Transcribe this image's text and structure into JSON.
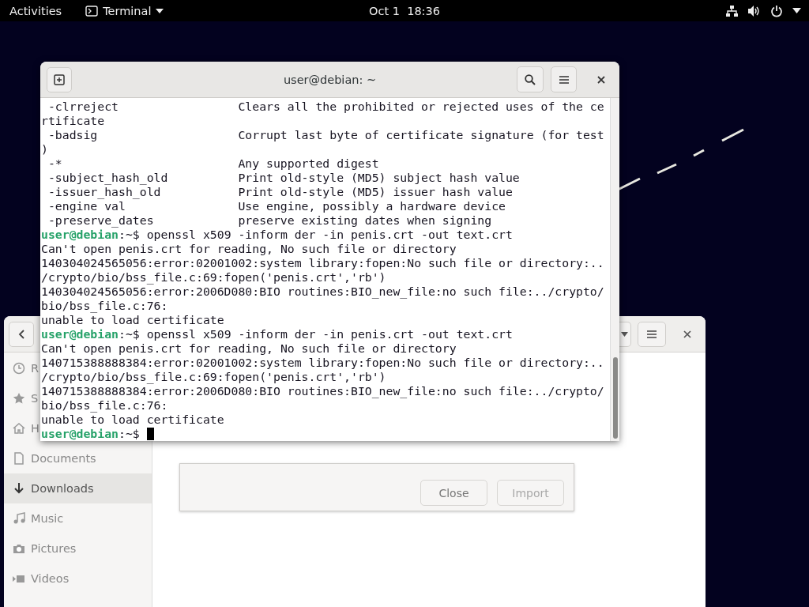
{
  "top_bar": {
    "activities": "Activities",
    "app_menu": "Terminal",
    "clock": "Oct 1  18:36"
  },
  "files_window": {
    "sidebar": [
      {
        "label": "R",
        "selected": false
      },
      {
        "label": "S",
        "selected": false
      },
      {
        "label": "H",
        "selected": false
      },
      {
        "label": "Documents",
        "selected": false
      },
      {
        "label": "Downloads",
        "selected": true
      },
      {
        "label": "Music",
        "selected": false
      },
      {
        "label": "Pictures",
        "selected": false
      },
      {
        "label": "Videos",
        "selected": false
      }
    ],
    "dialog": {
      "buttons": [
        {
          "label": "Close",
          "disabled": false
        },
        {
          "label": "Import",
          "disabled": true
        }
      ]
    }
  },
  "terminal": {
    "title": "user@debian: ~",
    "lines": [
      {
        "kind": "option",
        "option": " -clrreject",
        "description": "Clears all the prohibited or rejected uses of the ce"
      },
      {
        "kind": "text",
        "text": "rtificate"
      },
      {
        "kind": "option",
        "option": " -badsig",
        "description": "Corrupt last byte of certificate signature (for test"
      },
      {
        "kind": "text",
        "text": ")"
      },
      {
        "kind": "option",
        "option": " -*",
        "description": "Any supported digest"
      },
      {
        "kind": "option",
        "option": " -subject_hash_old",
        "description": "Print old-style (MD5) subject hash value"
      },
      {
        "kind": "option",
        "option": " -issuer_hash_old",
        "description": "Print old-style (MD5) issuer hash value"
      },
      {
        "kind": "option",
        "option": " -engine val",
        "description": "Use engine, possibly a hardware device"
      },
      {
        "kind": "option",
        "option": " -preserve_dates",
        "description": "preserve existing dates when signing"
      },
      {
        "kind": "prompt",
        "user": "user@debian",
        "path": ":~$",
        "command": "openssl x509 -inform der -in penis.crt -out text.crt"
      },
      {
        "kind": "text",
        "text": "Can't open penis.crt for reading, No such file or directory"
      },
      {
        "kind": "text",
        "text": "140304024565056:error:02001002:system library:fopen:No such file or directory:.."
      },
      {
        "kind": "text",
        "text": "/crypto/bio/bss_file.c:69:fopen('penis.crt','rb')"
      },
      {
        "kind": "text",
        "text": "140304024565056:error:2006D080:BIO routines:BIO_new_file:no such file:../crypto/"
      },
      {
        "kind": "text",
        "text": "bio/bss_file.c:76:"
      },
      {
        "kind": "text",
        "text": "unable to load certificate"
      },
      {
        "kind": "prompt",
        "user": "user@debian",
        "path": ":~$",
        "command": "openssl x509 -inform der -in penis.crt -out text.crt"
      },
      {
        "kind": "text",
        "text": "Can't open penis.crt for reading, No such file or directory"
      },
      {
        "kind": "text",
        "text": "140715388888384:error:02001002:system library:fopen:No such file or directory:.."
      },
      {
        "kind": "text",
        "text": "/crypto/bio/bss_file.c:69:fopen('penis.crt','rb')"
      },
      {
        "kind": "text",
        "text": "140715388888384:error:2006D080:BIO routines:BIO_new_file:no such file:../crypto/"
      },
      {
        "kind": "text",
        "text": "bio/bss_file.c:76:"
      },
      {
        "kind": "text",
        "text": "unable to load certificate"
      },
      {
        "kind": "prompt",
        "user": "user@debian",
        "path": ":~$",
        "cursor": true
      }
    ]
  }
}
